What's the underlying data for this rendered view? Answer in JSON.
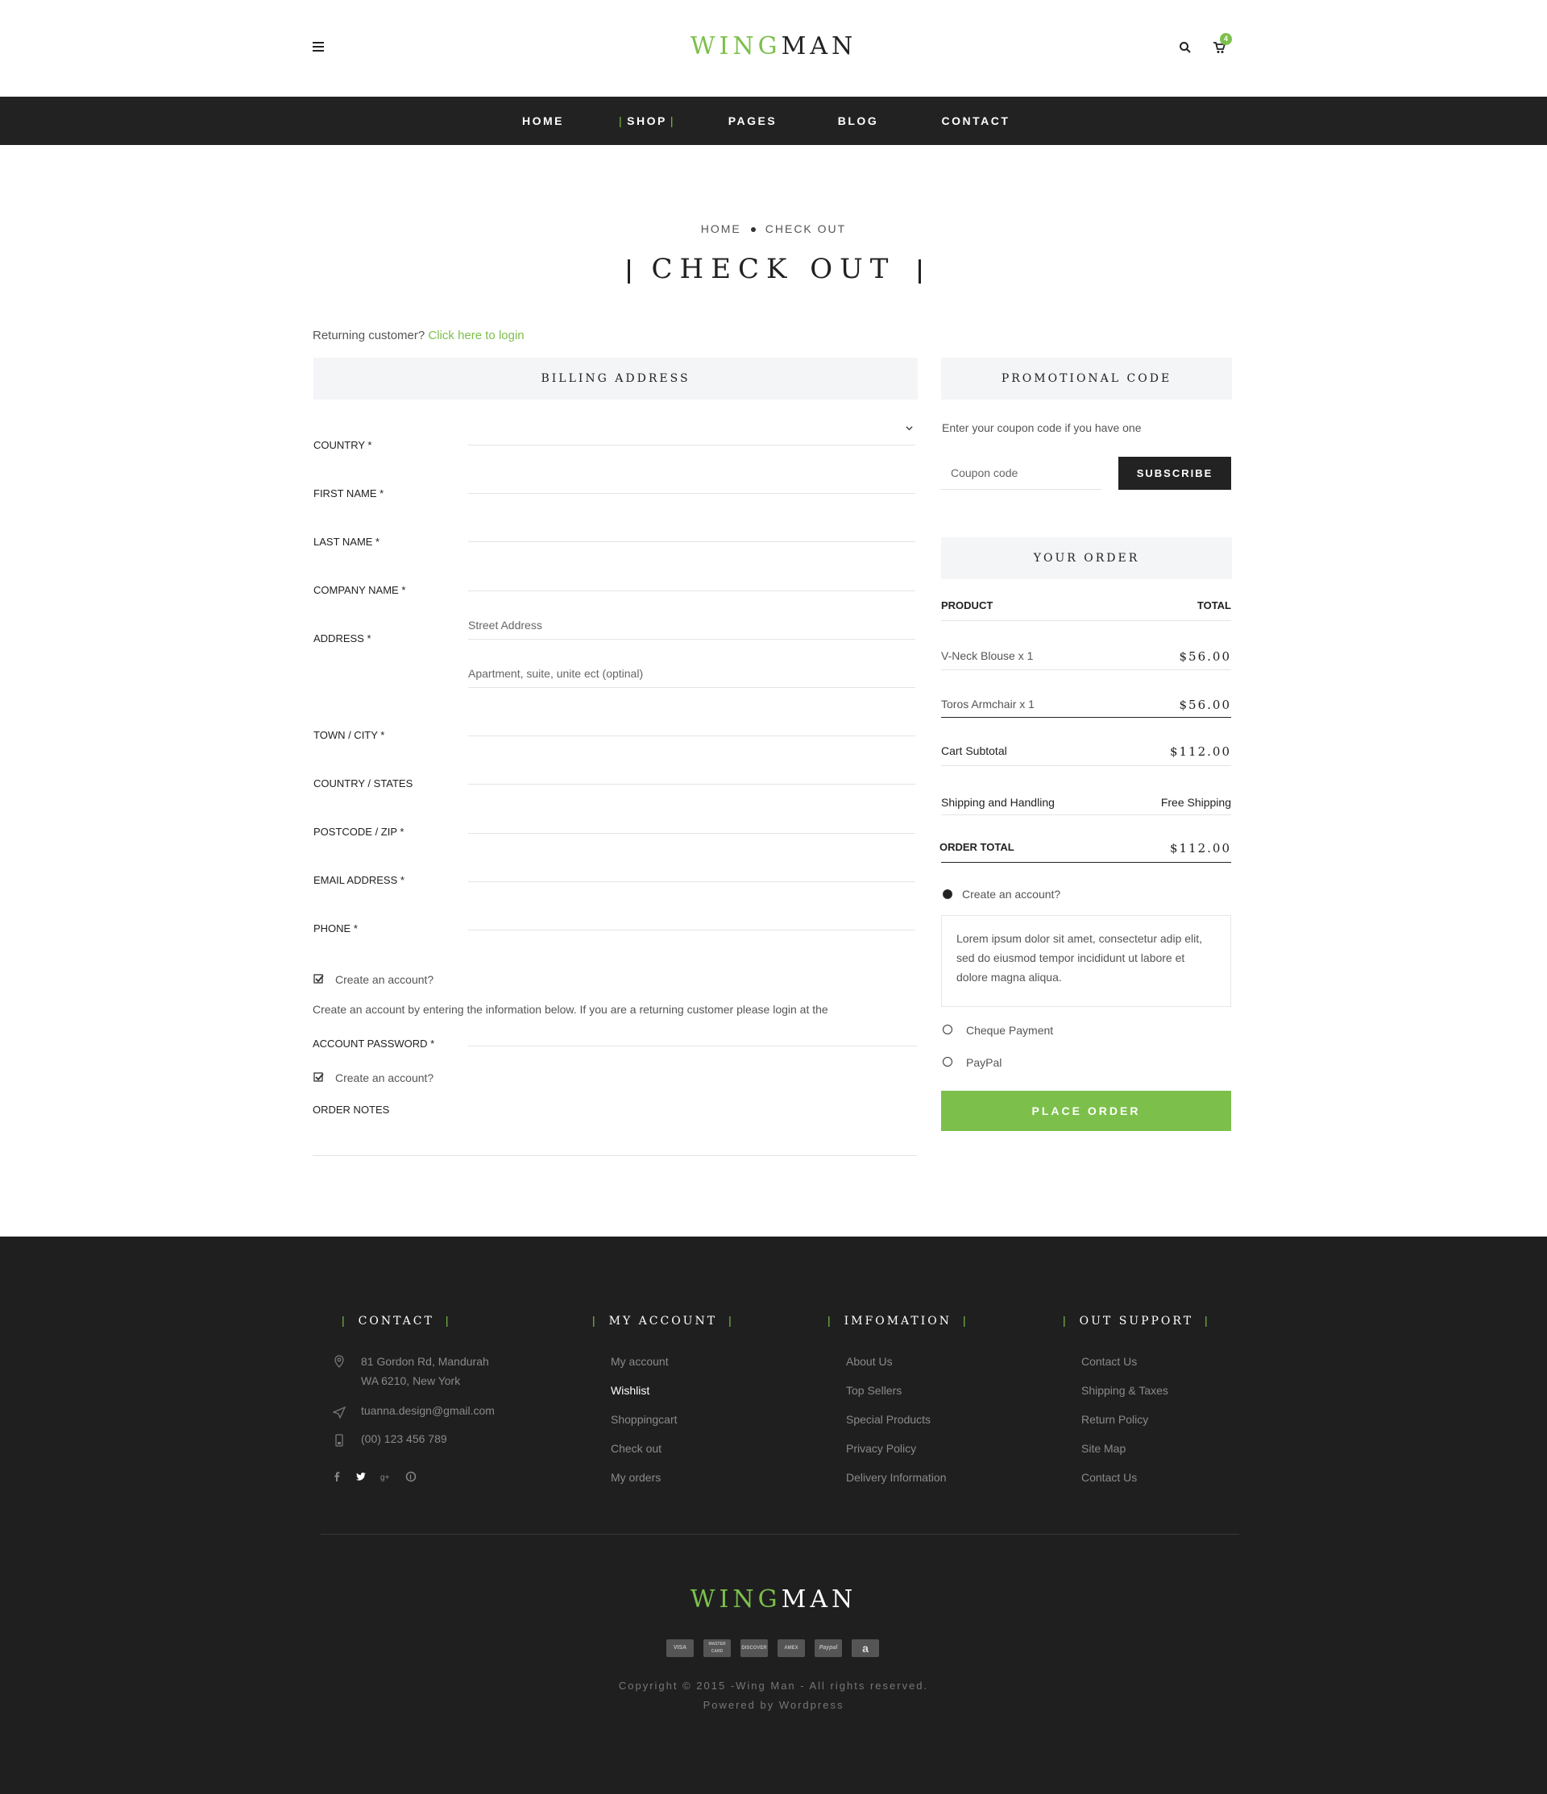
{
  "colors": {
    "accent": "#7cc04b",
    "dark": "#222222",
    "footer_bg": "#1f1f1f",
    "panel_bg": "#f4f5f7"
  },
  "header": {
    "logo_green": "WING",
    "logo_dark": "MAN",
    "cart_count": "4",
    "icons": [
      "menu-icon",
      "search-icon",
      "cart-icon"
    ]
  },
  "nav": {
    "home": "HOME",
    "shop": "SHOP",
    "pages": "PAGES",
    "blog": "BLOG",
    "contact": "CONTACT"
  },
  "breadcrumb": {
    "home": "HOME",
    "current": "CHECK OUT"
  },
  "page_title": "CHECK OUT",
  "returning": {
    "text": "Returning customer?",
    "link": "Click here to login"
  },
  "billing": {
    "heading": "BILLING ADDRESS",
    "labels": {
      "country": "COUNTRY *",
      "first_name": "FIRST NAME *",
      "last_name": "LAST NAME *",
      "company": "COMPANY NAME *",
      "address": "ADDRESS *",
      "town": "TOWN / CITY *",
      "states": "COUNTRY / STATES",
      "postcode": "POSTCODE / ZIP *",
      "email": "EMAIL ADDRESS *",
      "phone": "PHONE *",
      "password": "ACCOUNT PASSWORD *",
      "notes": "ORDER NOTES"
    },
    "placeholders": {
      "street": "Street Address",
      "apartment": "Apartment, suite, unite ect (optinal)"
    },
    "create_account": "Create an account?",
    "create_account_note": "Create an account by entering the information below. If you are a returning customer please login at the",
    "create_account_2": "Create an account?"
  },
  "promo": {
    "heading": "PROMOTIONAL CODE",
    "hint": "Enter your coupon code if you have one",
    "placeholder": "Coupon code",
    "button": "SUBSCRIBE"
  },
  "order": {
    "heading": "YOUR ORDER",
    "col_product": "PRODUCT",
    "col_total": "TOTAL",
    "items": [
      {
        "name": "V-Neck Blouse x 1",
        "price": "$56.00"
      },
      {
        "name": "Toros Armchair x 1",
        "price": "$56.00"
      }
    ],
    "subtotal_label": "Cart Subtotal",
    "subtotal": "$112.00",
    "shipping_label": "Shipping and Handling",
    "shipping": "Free Shipping",
    "total_label": "ORDER TOTAL",
    "total": "$112.00",
    "create_account": "Create an account?",
    "lorem": "Lorem ipsum dolor sit amet, consectetur adip elit, sed do eiusmod tempor incididunt ut labore et dolore magna aliqua.",
    "payment_cheque": "Cheque Payment",
    "payment_paypal": "PayPal",
    "place_order": "PLACE ORDER"
  },
  "footer": {
    "contact": {
      "title": "CONTACT",
      "address1": "81 Gordon Rd, Mandurah",
      "address2": "WA 6210, New York",
      "email": "tuanna.design@gmail.com",
      "phone": "(00) 123 456 789"
    },
    "account": {
      "title": "MY ACCOUNT",
      "links": [
        "My account",
        "Wishlist",
        "Shoppingcart",
        "Check out",
        "My orders"
      ]
    },
    "info": {
      "title": "IMFOMATION",
      "links": [
        "About Us",
        "Top Sellers",
        "Special Products",
        "Privacy Policy",
        "Delivery Information"
      ]
    },
    "support": {
      "title": "OUT SUPPORT",
      "links": [
        "Contact Us",
        "Shipping & Taxes",
        "Return Policy",
        "Site Map",
        "Contact Us"
      ]
    },
    "logo_green": "WING",
    "logo_dark": "MAN",
    "payments": [
      "VISA",
      "MASTER CARD",
      "DISCOVER",
      "AMEX",
      "Paypal",
      "a"
    ],
    "copyright": "Copyright © 2015 -Wing Man - All rights reserved.",
    "powered": "Powered by Wordpress"
  }
}
